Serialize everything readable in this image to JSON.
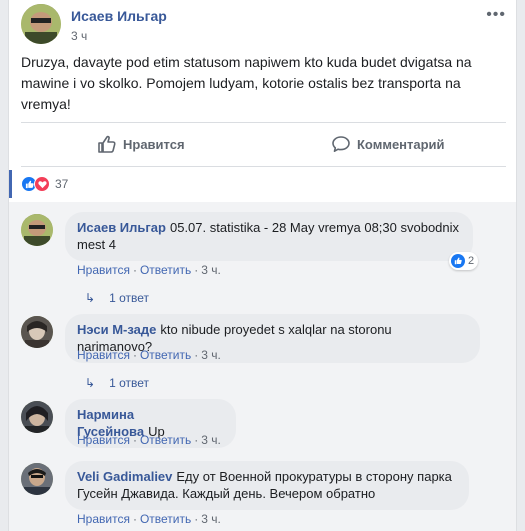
{
  "post": {
    "author": "Исаев Ильгар",
    "time": "3 ч",
    "more": "•••",
    "text": "Druzya, davayte pod etim statusom napiwem kto kuda budet dvigatsa na mawine i vo skolko. Pomojem ludyam, kotorie ostalis bez transporta na vremya!",
    "like_label": "Нравится",
    "comment_label": "Комментарий",
    "reaction_count": "37"
  },
  "comments": [
    {
      "name": "Исаев Ильгар",
      "text": "05.07. statistika - 28 May vremya 08;30 svobodnix mest 4",
      "like": "Нравится",
      "reply": "Ответить",
      "time": "3 ч.",
      "reaction_count": "2",
      "replies": "1 ответ"
    },
    {
      "name": "Нэси М-заде",
      "text": "kto nibude proyedet s xalqlar na storonu narimanovo?",
      "like": "Нравится",
      "reply": "Ответить",
      "time": "3 ч.",
      "replies": "1 ответ"
    },
    {
      "name": "Нармина Гусейнова",
      "text": "Up",
      "like": "Нравится",
      "reply": "Ответить",
      "time": "3 ч."
    },
    {
      "name": "Veli Gadimaliev",
      "text": "Еду от Военной прокуратуры в сторону парка Гусейн Джавида. Каждый день. Вечером обратно",
      "like": "Нравится",
      "reply": "Ответить",
      "time": "3 ч."
    }
  ],
  "colors": {
    "link": "#385898",
    "like_blue": "#1877f2",
    "love_red": "#f33e58"
  }
}
